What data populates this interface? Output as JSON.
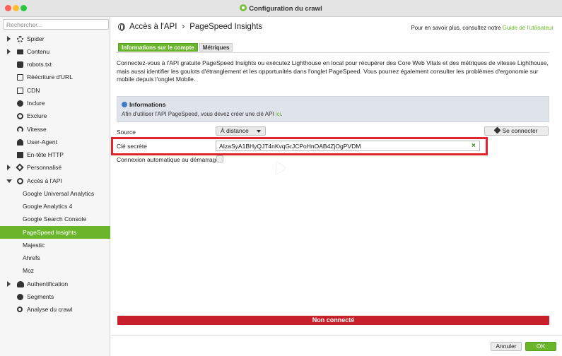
{
  "window": {
    "title": "Configuration du crawl"
  },
  "search": {
    "placeholder": "Rechercher..."
  },
  "sidebar": {
    "items": [
      {
        "label": "Spider",
        "icon": "gear-icon"
      },
      {
        "label": "Contenu",
        "icon": "folder-icon"
      },
      {
        "label": "robots.txt",
        "icon": "robot-icon"
      },
      {
        "label": "Réécriture d'URL",
        "icon": "rewrite-icon"
      },
      {
        "label": "CDN",
        "icon": "cdn-icon"
      },
      {
        "label": "Inclure",
        "icon": "include-icon"
      },
      {
        "label": "Exclure",
        "icon": "exclude-icon"
      },
      {
        "label": "Vitesse",
        "icon": "speed-icon"
      },
      {
        "label": "User-Agent",
        "icon": "user-icon"
      },
      {
        "label": "En-tête HTTP",
        "icon": "http-header-icon"
      },
      {
        "label": "Personnalisé",
        "icon": "custom-icon"
      },
      {
        "label": "Accès à l'API",
        "icon": "api-icon"
      },
      {
        "label": "Google Universal Analytics"
      },
      {
        "label": "Google Analytics 4"
      },
      {
        "label": "Google Search Console"
      },
      {
        "label": "PageSpeed Insights"
      },
      {
        "label": "Majestic"
      },
      {
        "label": "Ahrefs"
      },
      {
        "label": "Moz"
      },
      {
        "label": "Authentification",
        "icon": "authentication-icon"
      },
      {
        "label": "Segments",
        "icon": "segments-icon"
      },
      {
        "label": "Analyse du crawl",
        "icon": "crawl-analysis-icon"
      }
    ]
  },
  "header": {
    "section": "Accès à l'API",
    "page": "PageSpeed Insights",
    "separator": "›",
    "help_text": "Pour en savoir plus, consultez notre",
    "help_link": "Guide de l'utilisateur"
  },
  "tabs": [
    "Informations sur le compte",
    "Métriques"
  ],
  "description": "Connectez-vous à l'API gratuite PageSpeed Insights ou exécutez Lighthouse en local pour récupérer des Core Web Vitals et des métriques de vitesse Lighthouse, mais aussi identifier les goulots d'étranglement et les opportunités dans l'onglet PageSpeed. Vous pourrez également consulter les problèmes d'ergonomie sur mobile depuis l'onglet Mobile.",
  "info": {
    "title": "Informations",
    "text": "Afin d'utiliser l'API PageSpeed, vous devez créer une clé API",
    "link": "ici",
    "period": "."
  },
  "form": {
    "source_label": "Source",
    "source_value": "À distance",
    "connect_button": "Se connecter",
    "key_label": "Clé secrète",
    "key_value": "AIzaSyA1BHyQJT4nKvqGrJCPoHnOAB4ZjOgPVDM",
    "clear_glyph": "×",
    "auto_connect_label": "Connexion automatique au démarrage",
    "auto_connect_checked": false
  },
  "status": {
    "text": "Non connecté",
    "color": "#c7202a"
  },
  "footer": {
    "cancel": "Annuler",
    "ok": "OK"
  },
  "colors": {
    "accent": "#6bb52b",
    "highlight_box": "#e0232e"
  }
}
